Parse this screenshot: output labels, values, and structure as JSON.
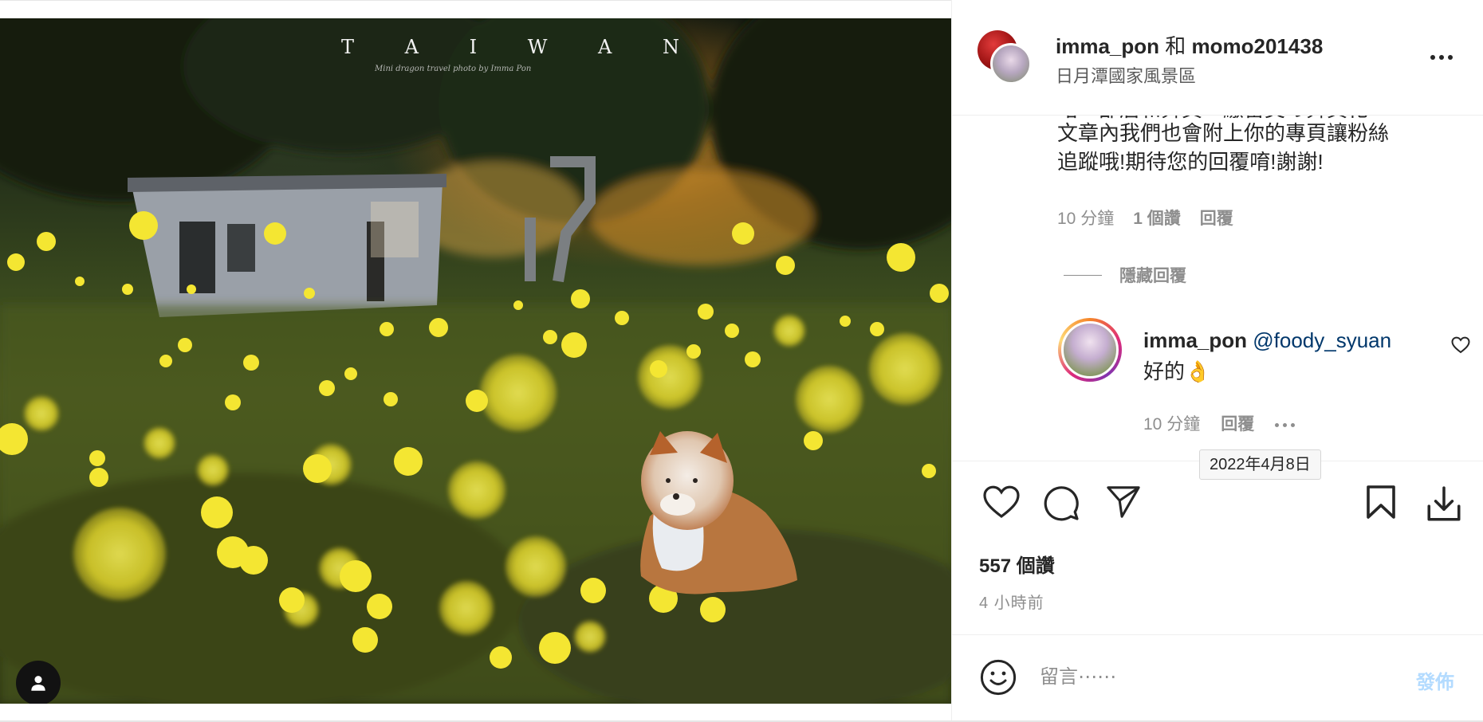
{
  "photo": {
    "title": "T A I W A N",
    "subtitle": "Mini dragon travel photo by Imma Pon"
  },
  "header": {
    "user1": "imma_pon",
    "joiner": "和",
    "user2": "momo201438",
    "location": "日月潭國家風景區"
  },
  "comment": {
    "line0": "堵一邵居和舞頁一繳留美の舞頁化",
    "line1": "文章內我們也會附上你的專頁讓粉絲",
    "line2": "追蹤哦!期待您的回覆唷!謝謝!",
    "time": "10 分鐘",
    "likes": "1 個讚",
    "reply": "回覆",
    "hide_replies": "隱藏回覆"
  },
  "reply": {
    "username": "imma_pon",
    "mention": "@foody_syuan",
    "text": "好的👌",
    "time": "10 分鐘",
    "reply_label": "回覆"
  },
  "tooltip": "2022年4月8日",
  "post": {
    "likes": "557 個讚",
    "time": "4 小時前"
  },
  "composer": {
    "placeholder": "留言⋯⋯",
    "post_label": "發佈"
  },
  "colors": {
    "accent_link": "#00376b",
    "post_disabled": "#b3dbff",
    "firefly": "#f4e632"
  }
}
